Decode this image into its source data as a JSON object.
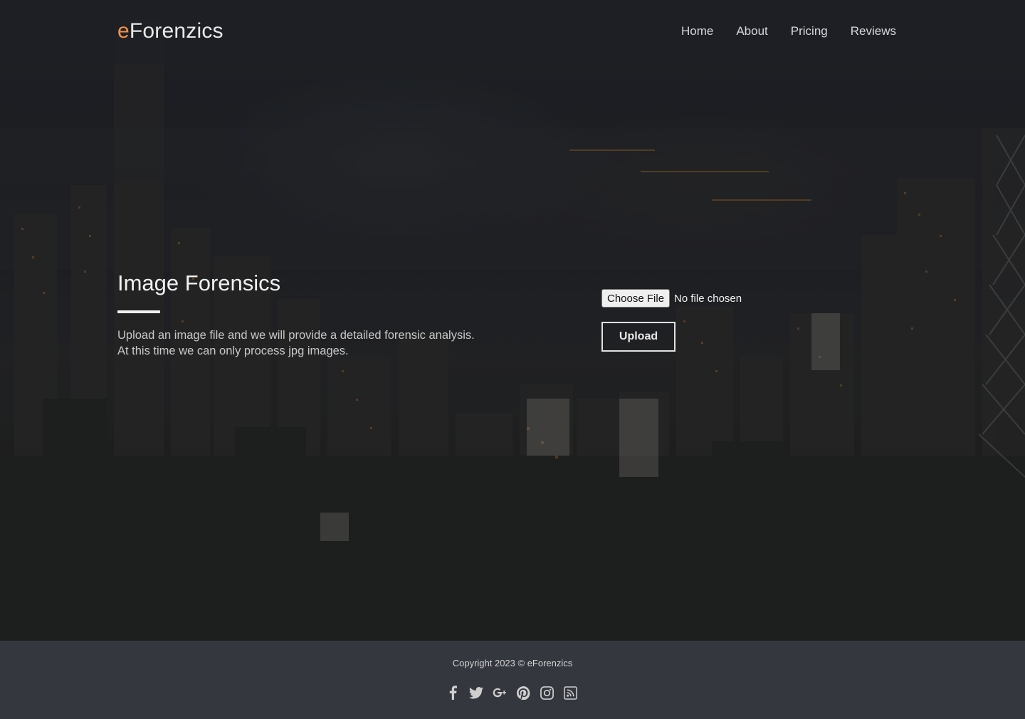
{
  "header": {
    "logo_accent": "e",
    "logo_rest": "Forenzics",
    "nav": [
      {
        "label": "Home"
      },
      {
        "label": "About"
      },
      {
        "label": "Pricing"
      },
      {
        "label": "Reviews"
      }
    ]
  },
  "main": {
    "title": "Image Forensics",
    "description_line1": "Upload an image file and we will provide a detailed forensic analysis.",
    "description_line2": "At this time we can only process jpg images.",
    "choose_file_label": "Choose File",
    "file_status": "No file chosen",
    "upload_label": "Upload"
  },
  "footer": {
    "copyright": "Copyright 2023 © eForenzics",
    "social_icons": [
      "facebook-icon",
      "twitter-icon",
      "google-plus-icon",
      "pinterest-icon",
      "instagram-icon",
      "rss-icon"
    ]
  },
  "colors": {
    "accent": "#f0924a",
    "header_bg": "#1e2026",
    "footer_bg": "#35373e"
  }
}
